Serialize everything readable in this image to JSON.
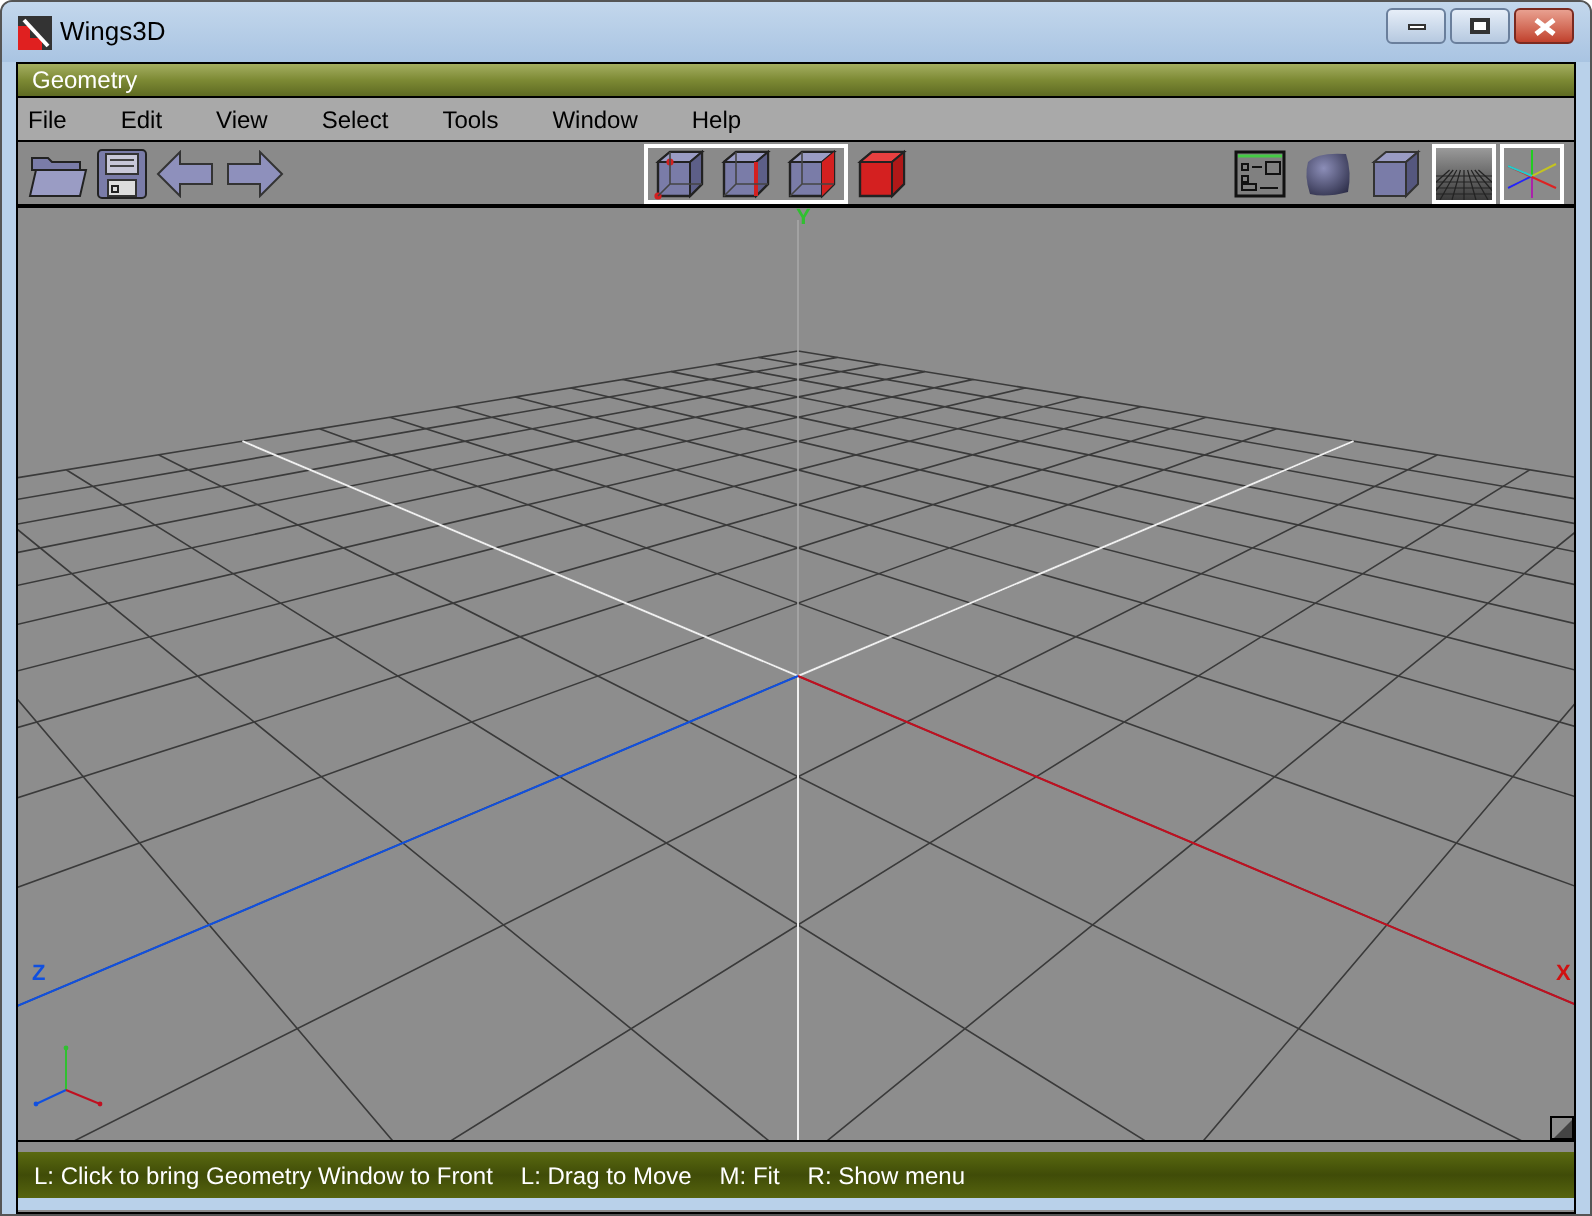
{
  "window": {
    "title": "Wings3D"
  },
  "panel": {
    "title": "Geometry"
  },
  "menu": [
    "File",
    "Edit",
    "View",
    "Select",
    "Tools",
    "Window",
    "Help"
  ],
  "selection_modes": [
    {
      "kind": "vertex",
      "selected": true
    },
    {
      "kind": "edge",
      "selected": true
    },
    {
      "kind": "face",
      "selected": true
    },
    {
      "kind": "body",
      "selected": false
    }
  ],
  "view_toggles": [
    {
      "kind": "outliner",
      "selected": false
    },
    {
      "kind": "smooth",
      "selected": false
    },
    {
      "kind": "flat",
      "selected": false
    },
    {
      "kind": "ground",
      "selected": true
    },
    {
      "kind": "axes",
      "selected": true
    }
  ],
  "viewport": {
    "axis_labels": [
      {
        "kind": "y",
        "text": "Y"
      },
      {
        "kind": "z",
        "text": "Z"
      },
      {
        "kind": "x",
        "text": "X"
      }
    ]
  },
  "status_bar": {
    "hints": [
      "L: Click to bring Geometry Window to Front",
      "L: Drag to Move",
      "M: Fit",
      "R: Show menu"
    ]
  }
}
